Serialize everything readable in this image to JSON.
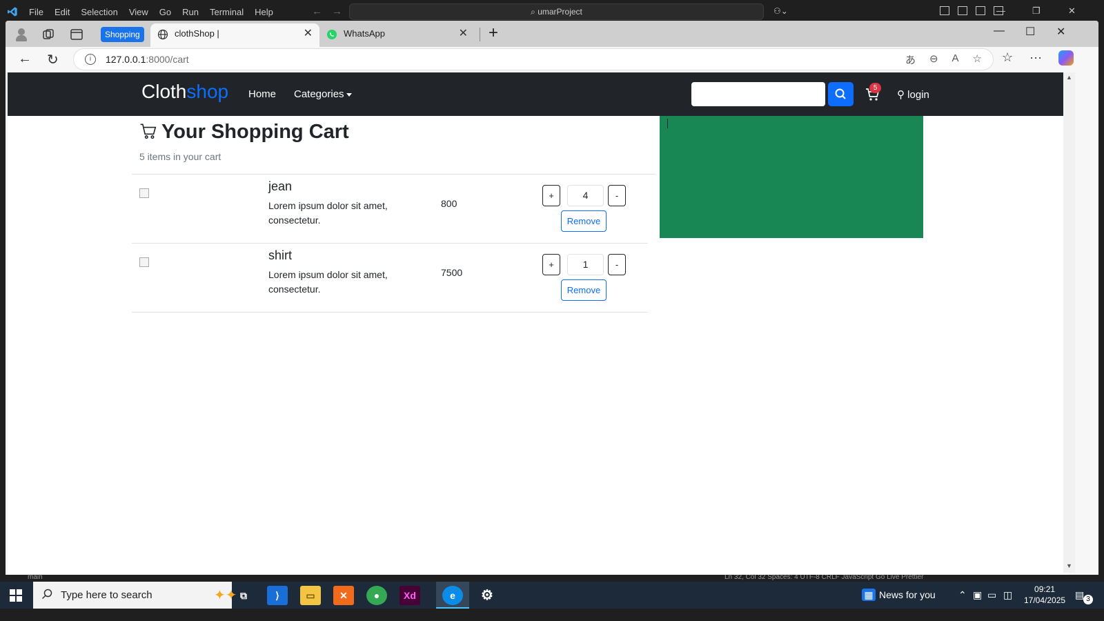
{
  "vscode": {
    "menu": [
      "File",
      "Edit",
      "Selection",
      "View",
      "Go",
      "Run",
      "Terminal",
      "Help"
    ],
    "search_text": "umarProject",
    "status_left": "main",
    "status_right": "Ln 32, Col 32   Spaces: 4   UTF-8   CRLF   JavaScript   Go Live   Prettier"
  },
  "browser": {
    "tab_group_label": "Shopping",
    "tabs": [
      {
        "title": "clothShop |",
        "active": true
      },
      {
        "title": "WhatsApp",
        "active": false
      }
    ],
    "url_host": "127.0.0.1",
    "url_path": ":8000/cart"
  },
  "site": {
    "brand_a": "Cloth",
    "brand_b": "shop",
    "nav": {
      "home": "Home",
      "categories": "Categories"
    },
    "search_placeholder": "",
    "cart_badge": "5",
    "login": "login"
  },
  "cart": {
    "title": "Your Shopping Cart",
    "count_text": "5 items in your cart",
    "items": [
      {
        "name": "jean",
        "description": "Lorem ipsum dolor sit amet, consectetur.",
        "price": "800",
        "quantity": "4",
        "plus": "+",
        "minus": "-",
        "remove": "Remove"
      },
      {
        "name": "shirt",
        "description": "Lorem ipsum dolor sit amet, consectetur.",
        "price": "7500",
        "quantity": "1",
        "plus": "+",
        "minus": "-",
        "remove": "Remove"
      }
    ]
  },
  "colors": {
    "navbar": "#212529",
    "primary": "#0d6efd",
    "summary_panel": "#198754",
    "badge": "#dc3545"
  },
  "taskbar": {
    "search_text": "Type here to search",
    "news": "News for you",
    "time": "09:21",
    "date": "17/04/2025",
    "notifications": "3"
  }
}
